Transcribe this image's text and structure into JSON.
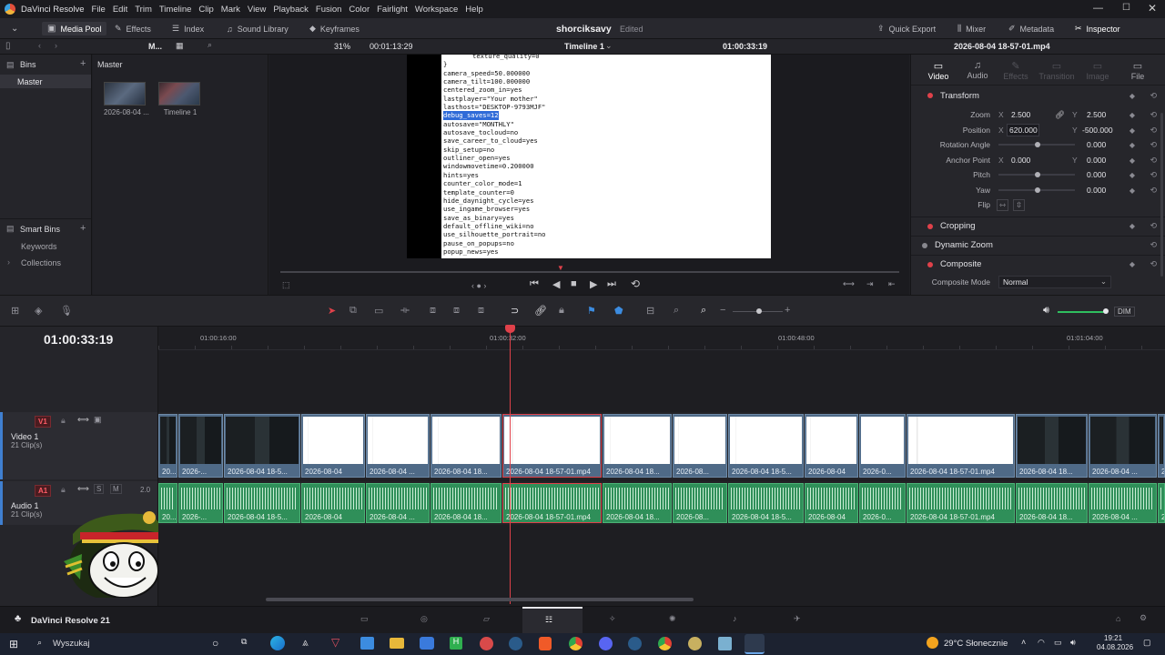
{
  "app": {
    "title": "DaVinci Resolve",
    "menu": [
      "File",
      "Edit",
      "Trim",
      "Timeline",
      "Clip",
      "Mark",
      "View",
      "Playback",
      "Fusion",
      "Color",
      "Fairlight",
      "Workspace",
      "Help"
    ]
  },
  "toolbar": {
    "media_pool": "Media Pool",
    "effects": "Effects",
    "index": "Index",
    "sound_library": "Sound Library",
    "keyframes": "Keyframes",
    "project_name": "shorciksavy",
    "project_status": "Edited",
    "quick_export": "Quick Export",
    "mixer": "Mixer",
    "metadata": "Metadata",
    "inspector": "Inspector"
  },
  "bar2": {
    "zoom": "31%",
    "source_tc": "00:01:13:29",
    "timeline_name": "Timeline 1",
    "record_tc": "01:00:33:19",
    "clip_name": "2026-08-04 18-57-01.mp4",
    "m_label": "M..."
  },
  "bins": {
    "header": "Bins",
    "master": "Master",
    "smart_bins": "Smart Bins",
    "keywords": "Keywords",
    "collections": "Collections"
  },
  "media_pool": {
    "breadcrumb": "Master",
    "items": [
      {
        "name": "2026-08-04 ..."
      },
      {
        "name": "Timeline 1"
      }
    ]
  },
  "viewer_text": [
    "texture_quality=0",
    "}",
    "camera_speed=50.000000",
    "camera_tilt=100.000000",
    "centered_zoom_in=yes",
    "lastplayer=\"Your mother\"",
    "lasthost=\"DESKTOP-9793MJF\"",
    "debug_saves=12",
    "autosave=\"MONTHLY\"",
    "autosave_tocloud=no",
    "save_career_to_cloud=yes",
    "skip_setup=no",
    "outliner_open=yes",
    "windowmovetime=0.200000",
    "hints=yes",
    "counter_color_mode=1",
    "template_counter=0",
    "hide_daynight_cycle=yes",
    "use_ingame_browser=yes",
    "save_as_binary=yes",
    "default_offline_wiki=no",
    "use_silhouette_portrait=no",
    "pause_on_popups=no",
    "popup_news=yes",
    "popup_over..."
  ],
  "inspector": {
    "tabs": [
      "Video",
      "Audio",
      "Effects",
      "Transition",
      "Image",
      "File"
    ],
    "transform": "Transform",
    "zoom_label": "Zoom",
    "zoom_x": "2.500",
    "zoom_y": "2.500",
    "position_label": "Position",
    "pos_x": "620.000",
    "pos_y": "-500.000",
    "rotation_label": "Rotation Angle",
    "rotation": "0.000",
    "anchor_label": "Anchor Point",
    "anchor_x": "0.000",
    "anchor_y": "0.000",
    "pitch_label": "Pitch",
    "pitch": "0.000",
    "yaw_label": "Yaw",
    "yaw": "0.000",
    "flip_label": "Flip",
    "x": "X",
    "y": "Y",
    "cropping": "Cropping",
    "dynamic_zoom": "Dynamic Zoom",
    "composite": "Composite",
    "composite_mode_label": "Composite Mode",
    "composite_mode": "Normal"
  },
  "timeline": {
    "timecode": "01:00:33:19",
    "ruler": [
      "01:00:16:00",
      "01:00:32:00",
      "01:00:48:00",
      "01:01:04:00"
    ],
    "v1": {
      "badge": "V1",
      "name": "Video 1",
      "clips": "21 Clip(s)"
    },
    "a1": {
      "badge": "A1",
      "name": "Audio 1",
      "clips": "21 Clip(s)",
      "level": "2.0",
      "s": "S",
      "m": "M"
    },
    "dim": "DIM"
  },
  "clips": [
    {
      "label": "20...",
      "thumb": "dark"
    },
    {
      "label": "2026-...",
      "thumb": "dark"
    },
    {
      "label": "2026-08-04 18-5...",
      "thumb": "dark"
    },
    {
      "label": "2026-08-04",
      "thumb": "white"
    },
    {
      "label": "2026-08-04 ...",
      "thumb": "white"
    },
    {
      "label": "2026-08-04 18...",
      "thumb": "white"
    },
    {
      "label": "2026-08-04 18-57-01.mp4",
      "thumb": "white"
    },
    {
      "label": "2026-08-04 18...",
      "thumb": "white"
    },
    {
      "label": "2026-08...",
      "thumb": "white"
    },
    {
      "label": "2026-08-04 18-5...",
      "thumb": "white"
    },
    {
      "label": "2026-08-04",
      "thumb": "white"
    },
    {
      "label": "2026-0...",
      "thumb": "white"
    },
    {
      "label": "2026-08-04 18-57-01.mp4",
      "thumb": "white"
    },
    {
      "label": "2026-08-04 18...",
      "thumb": "dark"
    },
    {
      "label": "2026-08-04 ...",
      "thumb": "dark"
    },
    {
      "label": "2...",
      "thumb": "dark"
    }
  ],
  "pagebar": {
    "brand": "DaVinci Resolve 21"
  },
  "taskbar": {
    "search": "Wyszukaj",
    "weather": "29°C Słonecznie",
    "time": "19:21",
    "date": "04.08.2026"
  }
}
